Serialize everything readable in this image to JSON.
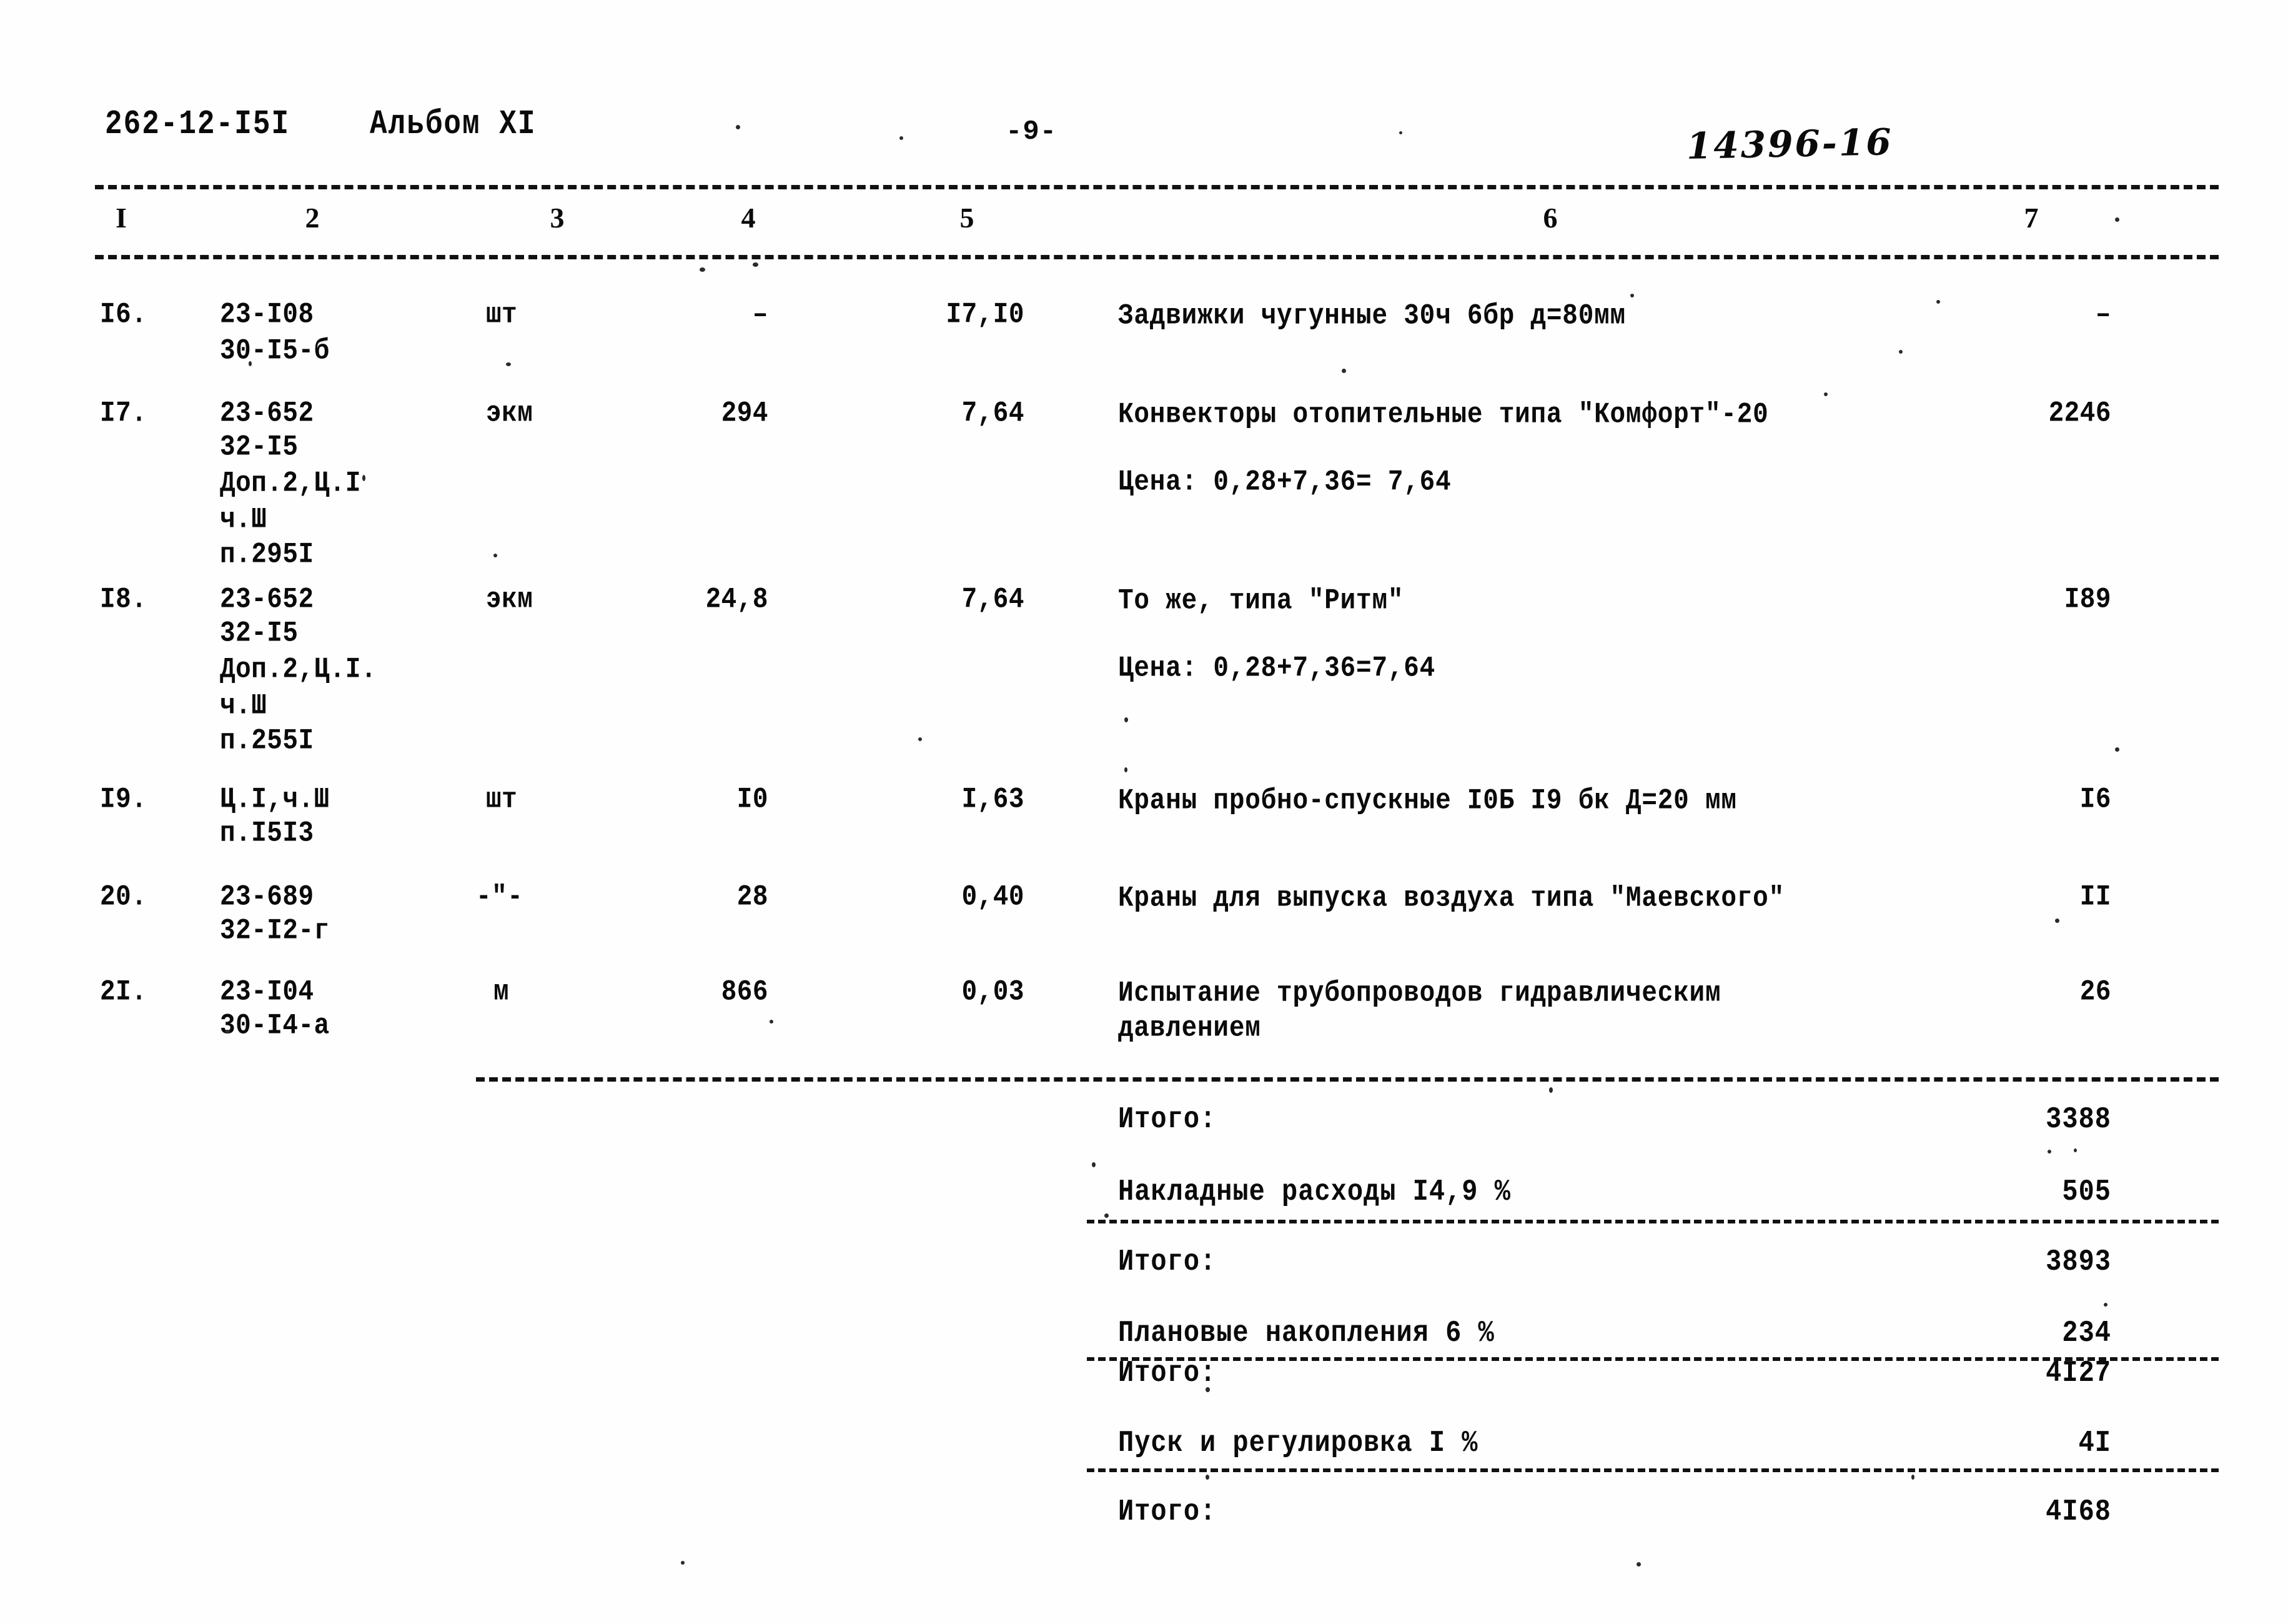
{
  "header": {
    "doc_code": "262-12-I5I",
    "album": "Альбом XI",
    "page_marker": "-9-",
    "stamp_number": "14396-16"
  },
  "table": {
    "column_headers": [
      "I",
      "2",
      "3",
      "4",
      "5",
      "6",
      "7"
    ],
    "rows": [
      {
        "no": "I6.",
        "code_lines": [
          "23-I08",
          "30-I5-б"
        ],
        "unit": "шт",
        "qty": "–",
        "price": "I7,I0",
        "desc_lines": [
          "Задвижки чугунные 30ч 6бр д=80мм"
        ],
        "total": "–"
      },
      {
        "no": "I7.",
        "code_lines": [
          "23-652",
          "32-I5",
          "Доп.2,Ц.I",
          "ч.Ш",
          "п.295I"
        ],
        "unit": "экм",
        "qty": "294",
        "price": "7,64",
        "desc_lines": [
          "Конвекторы отопительные типа \"Комфорт\"-20",
          "Цена: 0,28+7,36= 7,64"
        ],
        "total": "2246"
      },
      {
        "no": "I8.",
        "code_lines": [
          "23-652",
          "32-I5",
          "Доп.2,Ц.I.",
          "ч.Ш",
          "п.255I"
        ],
        "unit": "экм",
        "qty": "24,8",
        "price": "7,64",
        "desc_lines": [
          "То же, типа \"Ритм\"",
          "Цена: 0,28+7,36=7,64"
        ],
        "total": "I89"
      },
      {
        "no": "I9.",
        "code_lines": [
          "Ц.I,ч.Ш",
          "п.I5I3"
        ],
        "unit": "шт",
        "qty": "I0",
        "price": "I,63",
        "desc_lines": [
          "Краны пробно-спускные I0Б I9 бк Д=20 мм"
        ],
        "total": "I6"
      },
      {
        "no": "20.",
        "code_lines": [
          "23-689",
          "32-I2-г"
        ],
        "unit": "-\"-",
        "qty": "28",
        "price": "0,40",
        "desc_lines": [
          "Краны для выпуска воздуха типа \"Маевского\""
        ],
        "total": "II"
      },
      {
        "no": "2I.",
        "code_lines": [
          "23-I04",
          "30-I4-а"
        ],
        "unit": "м",
        "qty": "866",
        "price": "0,03",
        "desc_lines": [
          "Испытание трубопроводов гидравлическим",
          "давлением"
        ],
        "total": "26"
      }
    ]
  },
  "summary": [
    {
      "label": "Итого:",
      "value": "3388"
    },
    {
      "label": "Накладные расходы I4,9 %",
      "value": "505"
    },
    {
      "label": "Итого:",
      "value": "3893"
    },
    {
      "label": "Плановые накопления 6 %",
      "value": "234"
    },
    {
      "label": "Итого:",
      "value": "4I27"
    },
    {
      "label": "Пуск и регулировка I %",
      "value": "4I"
    },
    {
      "label": "Итого:",
      "value": "4I68"
    }
  ]
}
